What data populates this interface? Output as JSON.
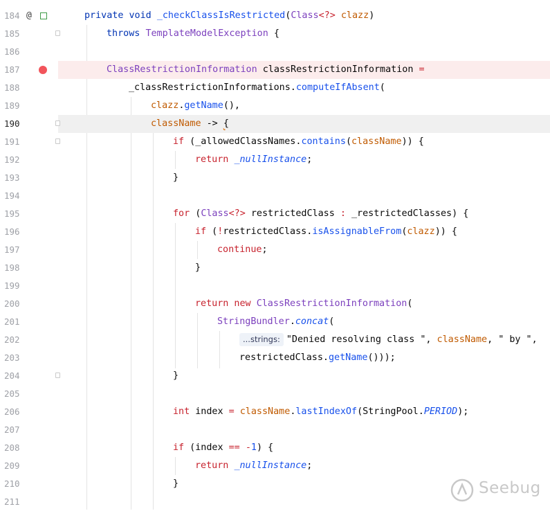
{
  "editor": {
    "active_line": "190",
    "breakpoint_line": "187",
    "parameter_hint": "...strings:",
    "lines": [
      {
        "number": "184",
        "text": "private void _checkClassIsRestricted(Class<?> clazz)"
      },
      {
        "number": "185",
        "text": "throws TemplateModelException {"
      },
      {
        "number": "186",
        "text": ""
      },
      {
        "number": "187",
        "text": "ClassRestrictionInformation classRestrictionInformation ="
      },
      {
        "number": "188",
        "text": "_classRestrictionInformations.computeIfAbsent("
      },
      {
        "number": "189",
        "text": "clazz.getName(),"
      },
      {
        "number": "190",
        "text": "className -> {"
      },
      {
        "number": "191",
        "text": "if (_allowedClassNames.contains(className)) {"
      },
      {
        "number": "192",
        "text": "return _nullInstance;"
      },
      {
        "number": "193",
        "text": "}"
      },
      {
        "number": "194",
        "text": ""
      },
      {
        "number": "195",
        "text": "for (Class<?> restrictedClass : _restrictedClasses) {"
      },
      {
        "number": "196",
        "text": "if (!restrictedClass.isAssignableFrom(clazz)) {"
      },
      {
        "number": "197",
        "text": "continue;"
      },
      {
        "number": "198",
        "text": "}"
      },
      {
        "number": "199",
        "text": ""
      },
      {
        "number": "200",
        "text": "return new ClassRestrictionInformation("
      },
      {
        "number": "201",
        "text": "StringBundler.concat("
      },
      {
        "number": "202",
        "text": "\"Denied resolving class \", className, \" by \","
      },
      {
        "number": "203",
        "text": "restrictedClass.getName()));"
      },
      {
        "number": "204",
        "text": "}"
      },
      {
        "number": "205",
        "text": ""
      },
      {
        "number": "206",
        "text": "int index = className.lastIndexOf(StringPool.PERIOD);"
      },
      {
        "number": "207",
        "text": ""
      },
      {
        "number": "208",
        "text": "if (index == -1) {"
      },
      {
        "number": "209",
        "text": "return _nullInstance;"
      },
      {
        "number": "210",
        "text": "}"
      },
      {
        "number": "211",
        "text": ""
      }
    ]
  },
  "gutter_icons": {
    "override_icon": "@",
    "implemented_icon": "implemented-icon",
    "breakpoint_color": "#f2545b"
  },
  "watermark": {
    "text": "Seebug",
    "icon": "seebug-logo-icon"
  },
  "colors": {
    "keyword": "#0033b3",
    "class": "#7b3fbd",
    "method": "#1750eb",
    "parameter": "#c05a00",
    "string": "#067d17",
    "operator": "#c7222d"
  }
}
